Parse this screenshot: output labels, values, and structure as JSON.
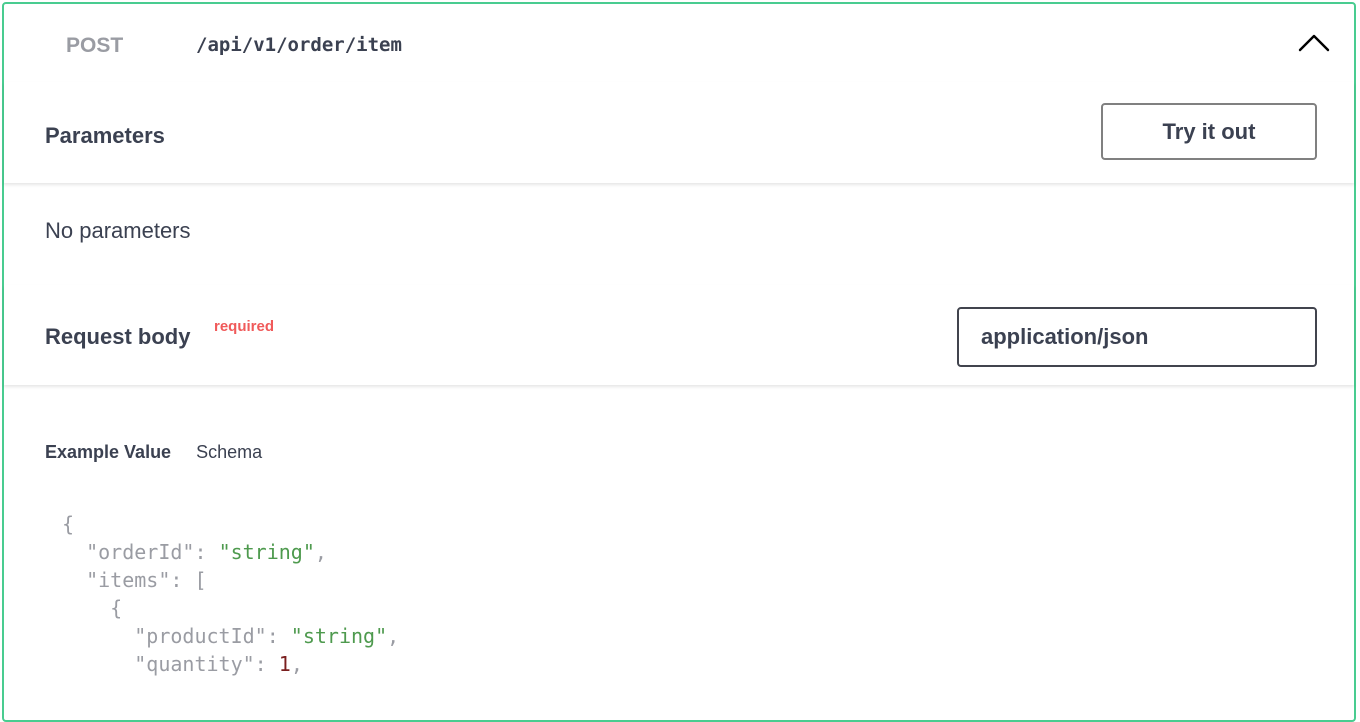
{
  "summary": {
    "method": "POST",
    "path": "/api/v1/order/item",
    "collapse_icon": "chevron-up-icon"
  },
  "parameters": {
    "title": "Parameters",
    "try_button": "Try it out",
    "empty_text": "No parameters"
  },
  "request_body": {
    "title": "Request body",
    "required_label": "required",
    "content_type": "application/json"
  },
  "example": {
    "tab_example": "Example Value",
    "tab_schema": "Schema",
    "lines": [
      {
        "indent": "",
        "key": "",
        "punct": "{",
        "value": "",
        "value_type": "",
        "trail": ""
      },
      {
        "indent": "  ",
        "key": "\"orderId\"",
        "punct": ": ",
        "value": "\"string\"",
        "value_type": "str",
        "trail": ","
      },
      {
        "indent": "  ",
        "key": "\"items\"",
        "punct": ": [",
        "value": "",
        "value_type": "",
        "trail": ""
      },
      {
        "indent": "    ",
        "key": "",
        "punct": "{",
        "value": "",
        "value_type": "",
        "trail": ""
      },
      {
        "indent": "      ",
        "key": "\"productId\"",
        "punct": ": ",
        "value": "\"string\"",
        "value_type": "str",
        "trail": ","
      },
      {
        "indent": "      ",
        "key": "\"quantity\"",
        "punct": ": ",
        "value": "1",
        "value_type": "num",
        "trail": ","
      }
    ]
  },
  "colors": {
    "accent": "#49cc90",
    "text": "#3b4151",
    "required": "#f05a5a",
    "string": "#4e9a4e",
    "number": "#7a1f1f"
  }
}
